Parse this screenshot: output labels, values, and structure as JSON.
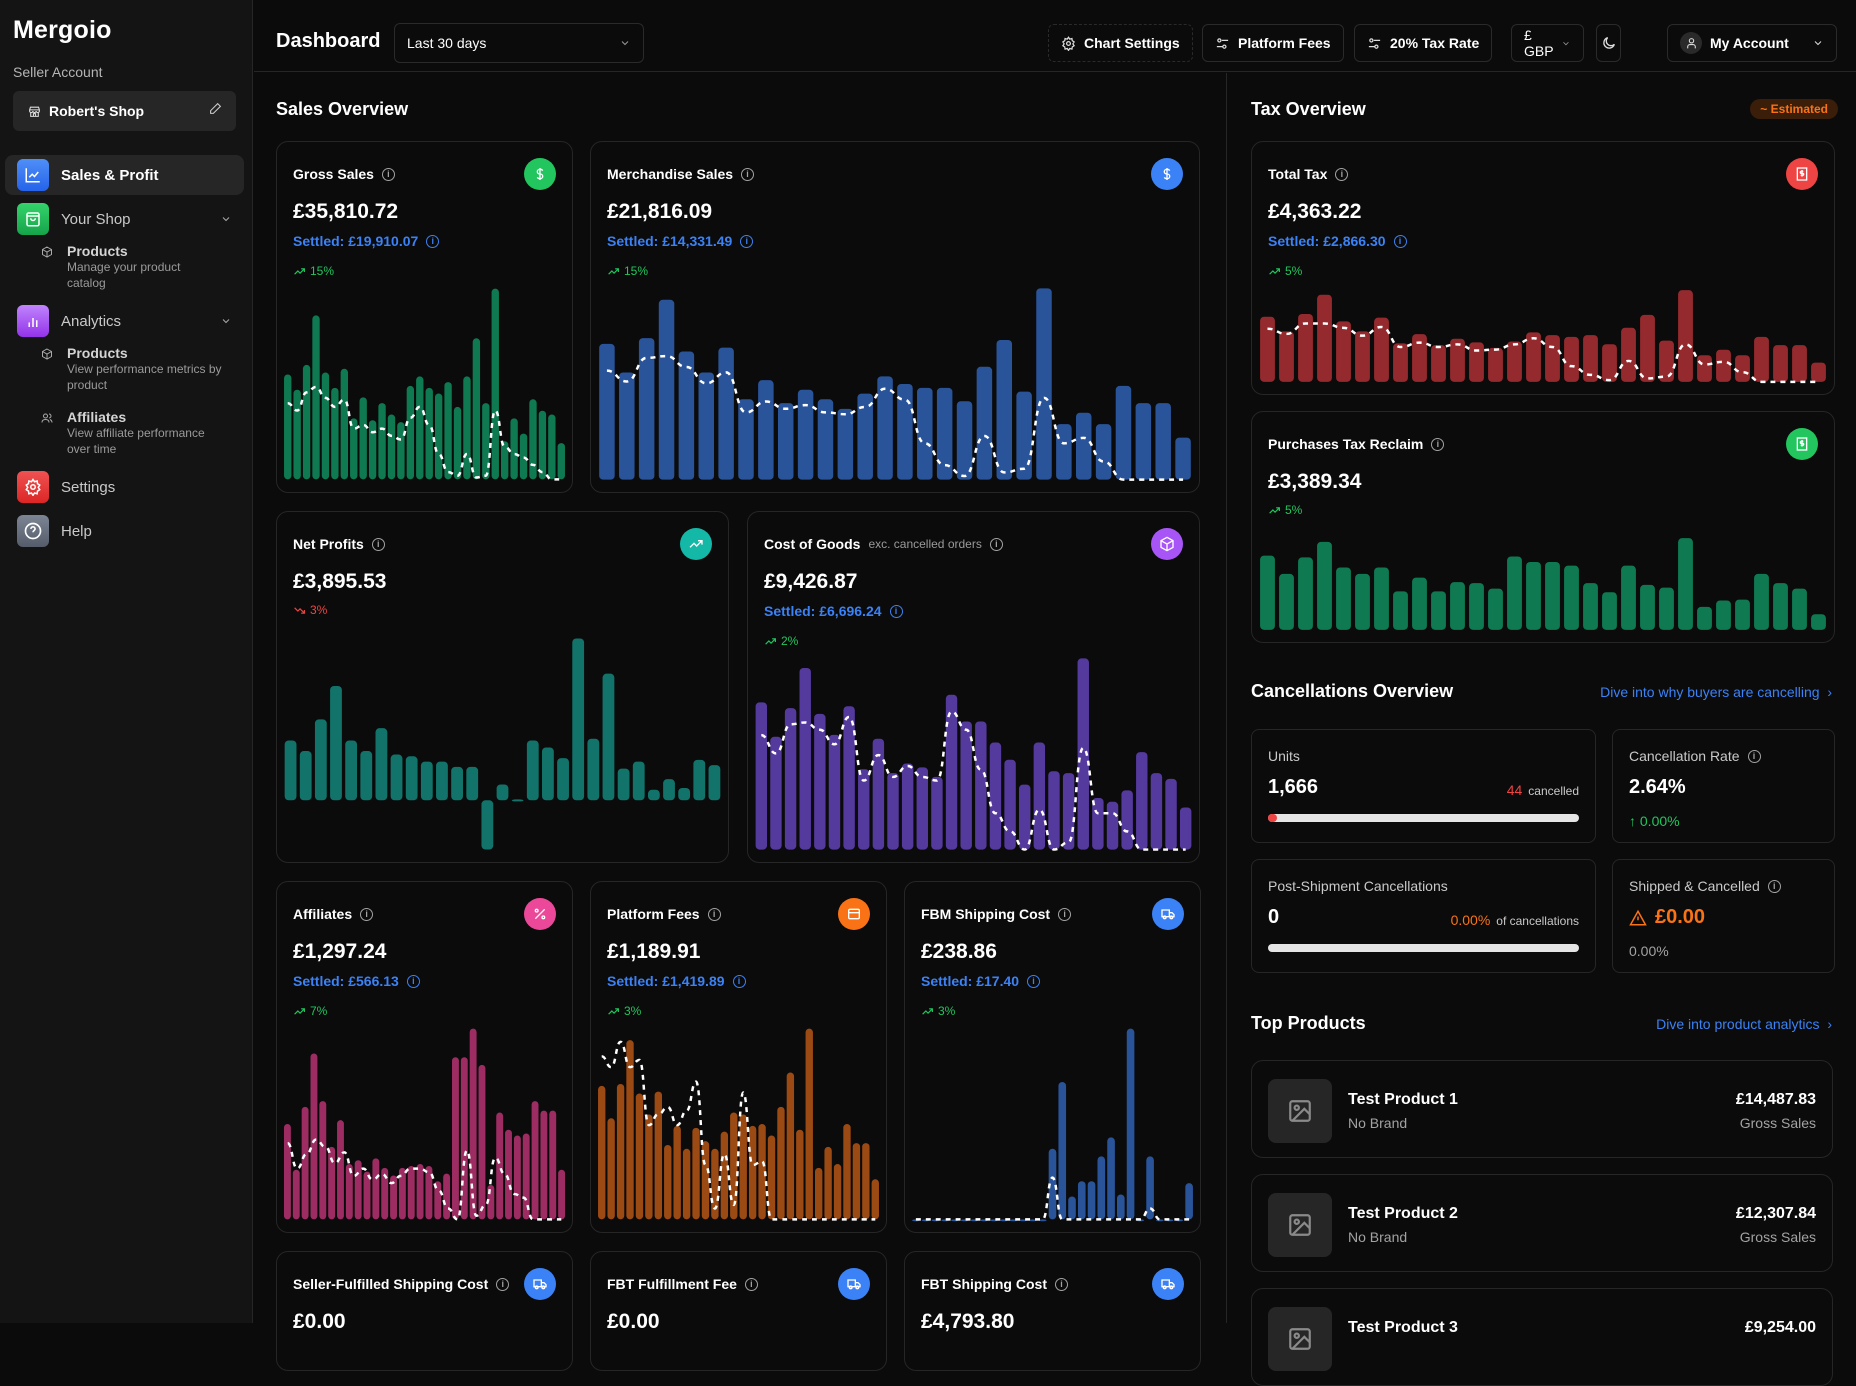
{
  "app": {
    "name": "Mergoio",
    "seller_label": "Seller Account",
    "shop_name": "Robert's Shop"
  },
  "sidebar": {
    "items": [
      {
        "label": "Sales & Profit",
        "icon": "chart-line-icon",
        "color": "#3b82f6",
        "active": true
      },
      {
        "label": "Your Shop",
        "icon": "shopping-bag-icon",
        "color": "#22c55e",
        "expandable": true
      },
      {
        "label": "Analytics",
        "icon": "bar-chart-icon",
        "color": "#a855f7",
        "expandable": true
      },
      {
        "label": "Settings",
        "icon": "gear-icon",
        "color": "#ef4444"
      },
      {
        "label": "Help",
        "icon": "help-circle-icon",
        "color": "#6b7280"
      }
    ],
    "shop_sub": [
      {
        "title": "Products",
        "desc": "Manage your product catalog",
        "icon": "package-icon"
      }
    ],
    "analytics_sub": [
      {
        "title": "Products",
        "desc": "View performance metrics by product",
        "icon": "package-icon"
      },
      {
        "title": "Affiliates",
        "desc": "View affiliate performance over time",
        "icon": "users-icon"
      }
    ]
  },
  "topbar": {
    "title": "Dashboard",
    "date_range": "Last 30 days",
    "chart_settings": "Chart Settings",
    "platform_fees": "Platform Fees",
    "tax_rate": "20% Tax Rate",
    "currency": "£ GBP",
    "account": "My Account"
  },
  "sales_overview": {
    "title": "Sales Overview",
    "cards": [
      {
        "id": "gross",
        "title": "Gross Sales",
        "value": "£35,810.72",
        "settled": "Settled: £19,910.07",
        "trend": "15%",
        "dir": "up",
        "icon": "dollar-icon",
        "icon_color": "#22c55e",
        "bar_color": "#0f7a52"
      },
      {
        "id": "merch",
        "title": "Merchandise Sales",
        "value": "£21,816.09",
        "settled": "Settled: £14,331.49",
        "trend": "15%",
        "dir": "up",
        "icon": "dollar-icon",
        "icon_color": "#3b82f6",
        "bar_color": "#2a5499"
      },
      {
        "id": "net",
        "title": "Net Profits",
        "value": "£3,895.53",
        "settled": "",
        "trend": "3%",
        "dir": "down",
        "icon": "trending-up-icon",
        "icon_color": "#14b8a6",
        "bar_color": "#12736a"
      },
      {
        "id": "cogs",
        "title": "Cost of Goods",
        "subtitle": "exc. cancelled orders",
        "value": "£9,426.87",
        "settled": "Settled: £6,696.24",
        "trend": "2%",
        "dir": "up",
        "icon": "package-icon",
        "icon_color": "#a855f7",
        "bar_color": "#553a9e"
      },
      {
        "id": "aff",
        "title": "Affiliates",
        "value": "£1,297.24",
        "settled": "Settled: £566.13",
        "trend": "7%",
        "dir": "up",
        "icon": "percent-icon",
        "icon_color": "#ec4899",
        "bar_color": "#9c2c62"
      },
      {
        "id": "pf",
        "title": "Platform Fees",
        "value": "£1,189.91",
        "settled": "Settled: £1,419.89",
        "trend": "3%",
        "dir": "up",
        "icon": "card-icon",
        "icon_color": "#f97316",
        "bar_color": "#9c4a14"
      },
      {
        "id": "fbm",
        "title": "FBM Shipping Cost",
        "value": "£238.86",
        "settled": "Settled: £17.40",
        "trend": "3%",
        "dir": "up",
        "icon": "truck-icon",
        "icon_color": "#3b82f6",
        "bar_color": "#2a5499"
      },
      {
        "id": "sfs",
        "title": "Seller-Fulfilled Shipping Cost",
        "value": "£0.00",
        "icon": "truck-icon",
        "icon_color": "#3b82f6"
      },
      {
        "id": "fbtf",
        "title": "FBT Fulfillment Fee",
        "value": "£0.00",
        "icon": "truck-icon",
        "icon_color": "#3b82f6"
      },
      {
        "id": "fbts",
        "title": "FBT Shipping Cost",
        "value": "£4,793.80",
        "icon": "truck-icon",
        "icon_color": "#3b82f6"
      }
    ]
  },
  "tax_overview": {
    "title": "Tax Overview",
    "badge": "~ Estimated",
    "cards": [
      {
        "id": "tax",
        "title": "Total Tax",
        "value": "£4,363.22",
        "settled": "Settled: £2,866.30",
        "trend": "5%",
        "dir": "up",
        "icon": "receipt-icon",
        "icon_color": "#ef4444",
        "bar_color": "#942a2e"
      },
      {
        "id": "reclaim",
        "title": "Purchases Tax Reclaim",
        "value": "£3,389.34",
        "settled": "",
        "trend": "5%",
        "dir": "up",
        "icon": "receipt-icon",
        "icon_color": "#22c55e",
        "bar_color": "#0f7a52"
      }
    ]
  },
  "cancellations": {
    "title": "Cancellations Overview",
    "link": "Dive into why buyers are cancelling",
    "units_label": "Units",
    "units": "1,666",
    "cancelled_count": "44",
    "cancelled_label": "cancelled",
    "cancelled_fraction": 0.0264,
    "rate_label": "Cancellation Rate",
    "rate": "2.64%",
    "rate_change": "↑ 0.00%",
    "post_label": "Post-Shipment Cancellations",
    "post_value": "0",
    "post_pct": "0.00%",
    "post_pct_label": "of cancellations",
    "shipped_label": "Shipped & Cancelled",
    "shipped_value": "£0.00",
    "shipped_pct": "0.00%"
  },
  "top_products": {
    "title": "Top Products",
    "link": "Dive into product analytics",
    "items": [
      {
        "name": "Test Product 1",
        "brand": "No Brand",
        "amount": "£14,487.83",
        "amount_label": "Gross Sales"
      },
      {
        "name": "Test Product 2",
        "brand": "No Brand",
        "amount": "£12,307.84",
        "amount_label": "Gross Sales"
      },
      {
        "name": "Test Product 3",
        "brand": "",
        "amount": "£9,254.00",
        "amount_label": ""
      }
    ]
  },
  "chart_data": [
    {
      "id": "gross",
      "type": "bar",
      "bars": [
        55,
        47,
        60,
        86,
        56,
        48,
        58,
        32,
        43,
        31,
        40,
        34,
        30,
        49,
        54,
        48,
        45,
        51,
        38,
        54,
        74,
        40,
        100,
        20,
        32,
        24,
        42,
        36,
        34,
        19
      ],
      "line": [
        42,
        38,
        48,
        51,
        45,
        40,
        44,
        28,
        30,
        26,
        28,
        24,
        22,
        34,
        40,
        30,
        14,
        4,
        2,
        14,
        1,
        2,
        38,
        18,
        14,
        12,
        8,
        4,
        0,
        0
      ]
    },
    {
      "id": "merch",
      "type": "bar",
      "bars": [
        71,
        56,
        74,
        94,
        67,
        56,
        69,
        42,
        52,
        40,
        47,
        42,
        37,
        45,
        54,
        50,
        48,
        48,
        41,
        59,
        73,
        46,
        100,
        29,
        35,
        29,
        49,
        40,
        40,
        22
      ],
      "line": [
        60,
        54,
        67,
        68,
        62,
        53,
        59,
        37,
        43,
        39,
        41,
        37,
        36,
        40,
        50,
        44,
        20,
        8,
        2,
        24,
        4,
        6,
        45,
        20,
        23,
        10,
        0,
        0,
        0,
        0
      ]
    },
    {
      "id": "net",
      "type": "bar",
      "bars": [
        34,
        28,
        46,
        65,
        34,
        28,
        41,
        26,
        25,
        22,
        22,
        19,
        19,
        -28,
        9,
        0.5,
        34,
        30,
        24,
        92,
        35,
        72,
        18,
        22,
        6,
        12,
        7,
        23,
        20
      ]
    },
    {
      "id": "cogs",
      "type": "bar",
      "bars": [
        77,
        59,
        74,
        95,
        71,
        60,
        75,
        42,
        58,
        40,
        45,
        43,
        38,
        81,
        67,
        67,
        56,
        47,
        34,
        56,
        41,
        40,
        100,
        27,
        25,
        31,
        51,
        40,
        37,
        22
      ],
      "line": [
        63,
        53,
        69,
        70,
        66,
        58,
        73,
        38,
        52,
        40,
        46,
        40,
        38,
        76,
        66,
        44,
        20,
        10,
        0,
        22,
        0,
        4,
        56,
        20,
        20,
        10,
        0,
        0,
        0,
        0
      ]
    },
    {
      "id": "aff",
      "type": "bar",
      "bars": [
        50,
        26,
        59,
        87,
        62,
        38,
        52,
        29,
        31,
        25,
        32,
        27,
        23,
        27,
        28,
        29,
        28,
        20,
        24,
        85,
        85,
        100,
        81,
        18,
        56,
        47,
        44,
        45,
        62,
        57,
        57,
        26
      ],
      "line": [
        42,
        28,
        36,
        44,
        40,
        31,
        37,
        24,
        28,
        22,
        25,
        20,
        24,
        28,
        28,
        26,
        16,
        6,
        0,
        38,
        2,
        8,
        34,
        25,
        14,
        12,
        0,
        0,
        0,
        0
      ]
    },
    {
      "id": "pf",
      "type": "bar",
      "bars": [
        70,
        53,
        71,
        94,
        66,
        55,
        67,
        39,
        49,
        37,
        48,
        41,
        37,
        46,
        56,
        55,
        49,
        50,
        44,
        59,
        77,
        47,
        100,
        27,
        38,
        29,
        50,
        40,
        40,
        21
      ],
      "line": [
        90,
        84,
        98,
        84,
        88,
        52,
        58,
        62,
        52,
        60,
        76,
        30,
        6,
        36,
        8,
        70,
        30,
        32,
        0,
        0,
        0,
        0,
        0,
        0,
        0,
        0,
        0,
        0,
        0,
        0
      ]
    },
    {
      "id": "fbm",
      "type": "bar",
      "bars": [
        0,
        0,
        0,
        0,
        0,
        0,
        0,
        0,
        0,
        0,
        0,
        0,
        0,
        0,
        37,
        72,
        12,
        20,
        20,
        33,
        43,
        13,
        100,
        0,
        33,
        0,
        0,
        0,
        19
      ],
      "line": [
        0,
        0,
        0,
        0,
        0,
        0,
        0,
        0,
        0,
        0,
        0,
        0,
        0,
        0,
        23,
        0,
        0,
        0,
        0,
        0,
        0,
        0,
        0,
        0,
        6,
        0,
        0,
        0,
        0
      ]
    },
    {
      "id": "tax",
      "type": "bar",
      "bars": [
        71,
        55,
        74,
        95,
        66,
        55,
        70,
        42,
        52,
        40,
        47,
        43,
        37,
        44,
        54,
        51,
        49,
        51,
        41,
        59,
        73,
        45,
        100,
        29,
        35,
        29,
        49,
        40,
        40,
        21
      ],
      "line": [
        61,
        55,
        67,
        67,
        62,
        53,
        63,
        40,
        45,
        40,
        43,
        36,
        37,
        43,
        50,
        40,
        18,
        8,
        2,
        24,
        4,
        6,
        43,
        20,
        23,
        11,
        0,
        0,
        0,
        0
      ]
    },
    {
      "id": "reclaim",
      "type": "bar",
      "bars": [
        81,
        61,
        79,
        96,
        68,
        61,
        68,
        42,
        57,
        42,
        52,
        51,
        45,
        80,
        74,
        74,
        70,
        51,
        41,
        70,
        49,
        46,
        100,
        25,
        32,
        33,
        61,
        51,
        45,
        17
      ]
    }
  ]
}
